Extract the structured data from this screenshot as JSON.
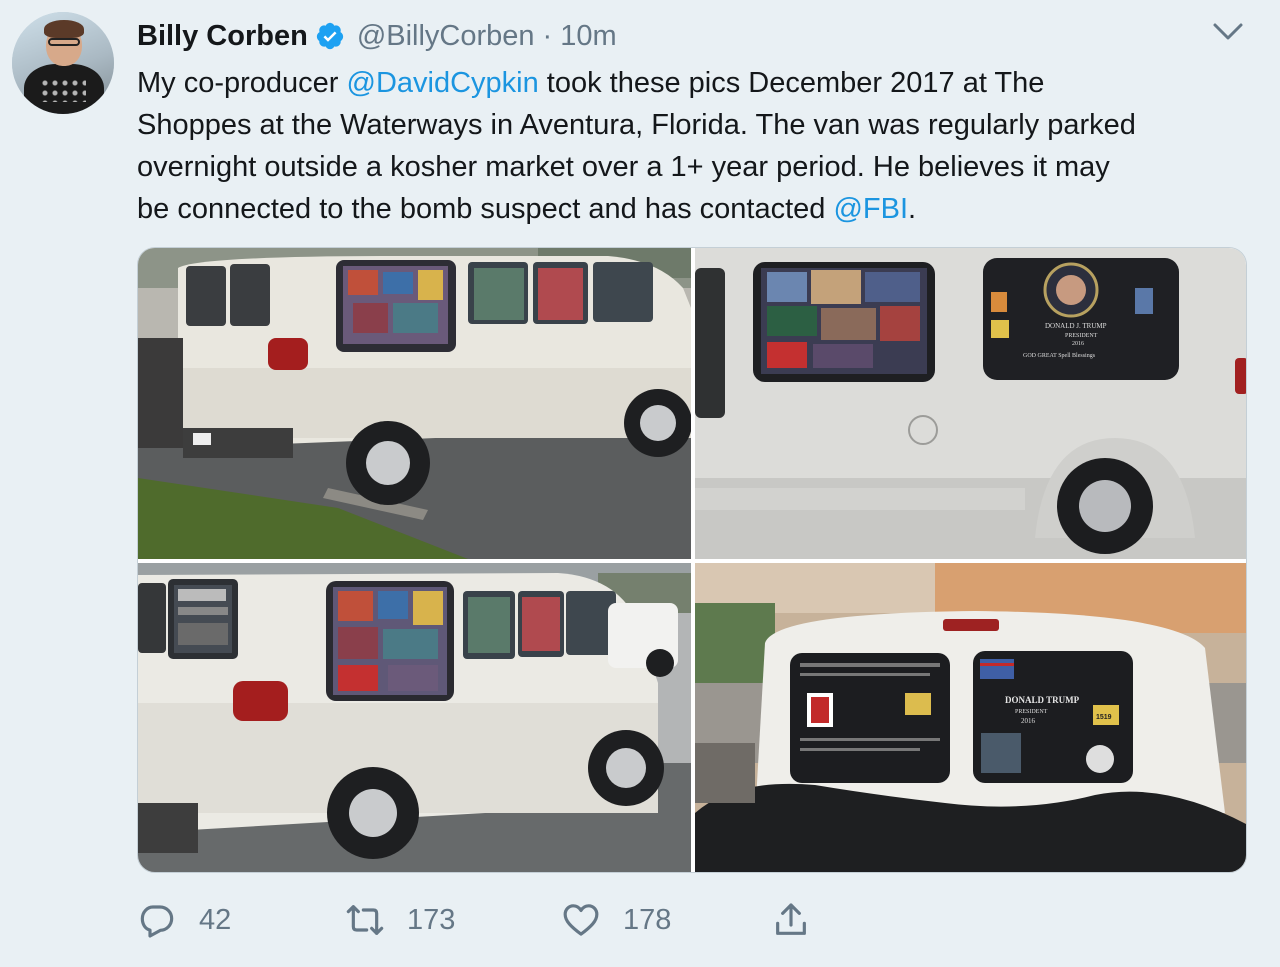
{
  "author": {
    "name": "Billy Corben",
    "handle": "@BillyCorben",
    "separator": "·",
    "time": "10m"
  },
  "tweet": {
    "line1_pre": "My co-producer ",
    "line1_mention": "@DavidCypkin",
    "line1_post": " took these pics December 2017 at The",
    "line2": "Shoppes at the Waterways in Aventura, Florida. The van was regularly parked",
    "line3": "overnight outside a kosher market over a 1+ year period. He believes it may",
    "line4_pre": "be connected to the bomb suspect and has contacted ",
    "line4_mention": "@FBI",
    "line4_post": "."
  },
  "photo_text": {
    "p2_window_1": "DONALD J. TRUMP",
    "p2_window_2": "PRESIDENT",
    "p2_window_3": "2016",
    "p2_window_4": "GOD GREAT Spell Blessings",
    "p4_window_1": "DONALD TRUMP",
    "p4_window_2": "PRESIDENT",
    "p4_window_3": "2016",
    "p4_badge": "1519"
  },
  "actions": {
    "replies": "42",
    "retweets": "173",
    "likes": "178"
  },
  "colors": {
    "link": "#1b95e0",
    "muted": "#657786",
    "verified": "#1da1f2",
    "background": "#e9f0f4"
  },
  "icons": {
    "verified": "verified-badge-icon",
    "menu": "chevron-down-icon",
    "reply": "reply-icon",
    "retweet": "retweet-icon",
    "like": "heart-icon",
    "share": "share-icon"
  }
}
